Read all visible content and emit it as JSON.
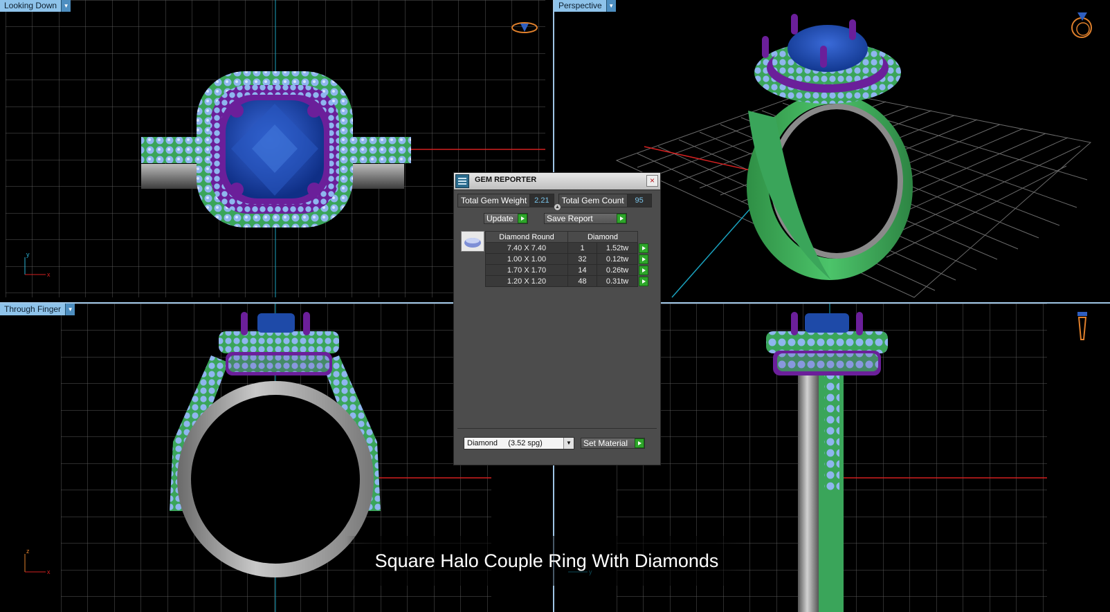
{
  "viewports": {
    "top_left": {
      "label": "Looking Down"
    },
    "top_right": {
      "label": "Perspective"
    },
    "bottom_left": {
      "label": "Through Finger"
    },
    "bottom_right": {
      "label": ""
    }
  },
  "axes": {
    "top_left": {
      "v": "y",
      "h": "x"
    },
    "bottom_left": {
      "v": "z",
      "h": "x"
    },
    "bottom_right": {
      "h": "y"
    }
  },
  "gem_reporter": {
    "title": "GEM REPORTER",
    "close_glyph": "×",
    "total_weight_label": "Total Gem Weight",
    "total_weight_value": "2.21",
    "total_count_label": "Total Gem Count",
    "total_count_value": "95",
    "update_label": "Update",
    "save_report_label": "Save Report",
    "table": {
      "headers": [
        "Diamond Round",
        "Diamond"
      ],
      "rows": [
        {
          "size": "7.40 X 7.40",
          "count": "1",
          "weight": "1.52tw"
        },
        {
          "size": "1.00 X 1.00",
          "count": "32",
          "weight": "0.12tw"
        },
        {
          "size": "1.70 X 1.70",
          "count": "14",
          "weight": "0.26tw"
        },
        {
          "size": "1.20 X 1.20",
          "count": "48",
          "weight": "0.31tw"
        }
      ]
    },
    "material_select": "Diamond     (3.52 spg)",
    "set_material_label": "Set Material"
  },
  "caption": "Square Halo Couple Ring With Diamonds",
  "colors": {
    "viewport_label_bg": "#8ec3ea",
    "grid": "#5a5a5a",
    "metal_green": "#3fae5a",
    "metal_gray": "#9a9a9a",
    "sapphire": "#1e4aa8",
    "prong_purple": "#6b1f9a",
    "melee": "#8fb6ef",
    "button_green": "#2ea52a"
  }
}
